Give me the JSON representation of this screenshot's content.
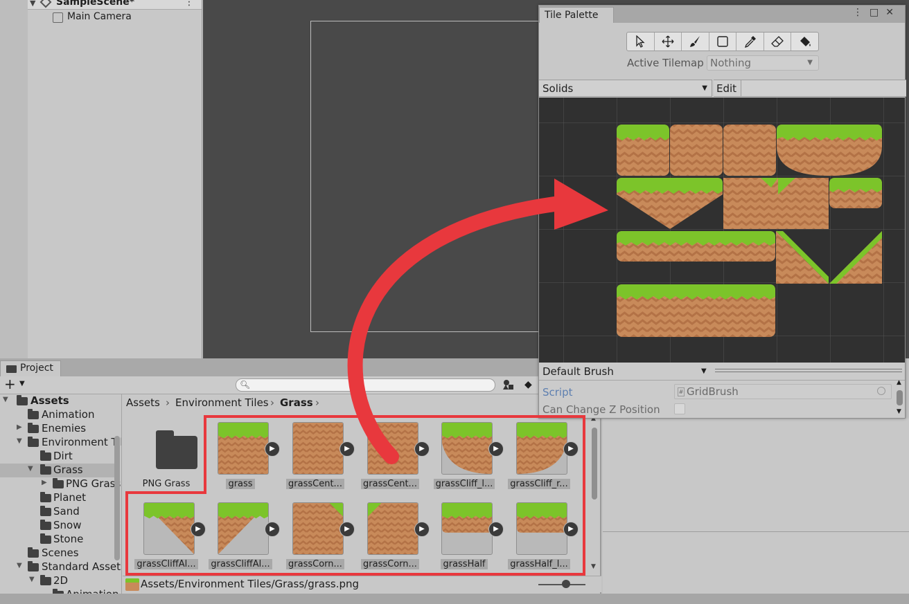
{
  "hierarchy": {
    "scene_name": "SampleScene*",
    "items": [
      {
        "label": "Main Camera"
      }
    ]
  },
  "project": {
    "tab_label": "Project",
    "tree": [
      {
        "label": "Assets",
        "bold": true
      },
      {
        "label": "Animation"
      },
      {
        "label": "Enemies"
      },
      {
        "label": "Environment Tiles"
      },
      {
        "label": "Dirt"
      },
      {
        "label": "Grass"
      },
      {
        "label": "PNG Grass"
      },
      {
        "label": "Planet"
      },
      {
        "label": "Sand"
      },
      {
        "label": "Snow"
      },
      {
        "label": "Stone"
      },
      {
        "label": "Scenes"
      },
      {
        "label": "Standard Assets"
      },
      {
        "label": "2D"
      },
      {
        "label": "Animation"
      }
    ],
    "breadcrumb": [
      "Assets",
      "Environment Tiles",
      "Grass"
    ],
    "assets": [
      {
        "label": "PNG Grass",
        "kind": "folder"
      },
      {
        "label": "grass",
        "kind": "top"
      },
      {
        "label": "grassCent...",
        "kind": "center"
      },
      {
        "label": "grassCent...",
        "kind": "center"
      },
      {
        "label": "grassCliff_l...",
        "kind": "cliffL"
      },
      {
        "label": "grassCliff_r...",
        "kind": "cliffR"
      },
      {
        "label": "grassCliffAl...",
        "kind": "cliffAltL"
      },
      {
        "label": "grassCliffAl...",
        "kind": "cliffAltR"
      },
      {
        "label": "grassCorn...",
        "kind": "cornerL"
      },
      {
        "label": "grassCorn...",
        "kind": "cornerR"
      },
      {
        "label": "grassHalf",
        "kind": "half"
      },
      {
        "label": "grassHalf_l...",
        "kind": "half"
      }
    ],
    "status_path": "Assets/Environment Tiles/Grass/grass.png"
  },
  "tile_palette": {
    "title": "Tile Palette",
    "tools": [
      "select-icon",
      "move-icon",
      "paint-brush-icon",
      "box-fill-icon",
      "picker-icon",
      "eraser-icon",
      "fill-bucket-icon"
    ],
    "active_tilemap_label": "Active Tilemap",
    "active_tilemap_value": "Nothing",
    "palette_name": "Solids",
    "edit_label": "Edit",
    "brush_name": "Default Brush",
    "script_label": "Script",
    "script_value": "GridBrush",
    "z_label": "Can Change Z Position"
  },
  "colors": {
    "grass": "#7cc42a",
    "grass_dark": "#5a9c1a",
    "dirt": "#c88a5a",
    "dirt_line": "#b37246",
    "arrow": "#e8383d",
    "highlight": "#e8383d"
  }
}
